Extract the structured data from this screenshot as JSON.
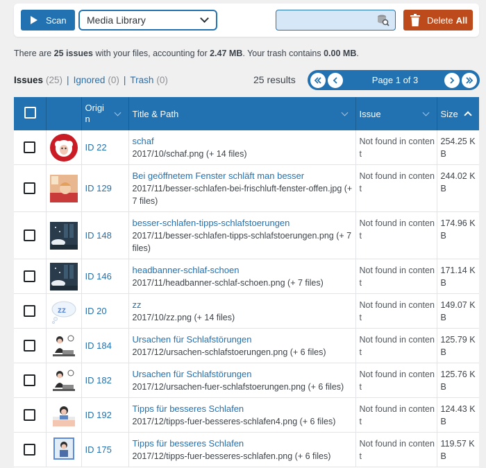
{
  "toolbar": {
    "scan_label": "Scan",
    "source_select": "Media Library",
    "search_placeholder": "",
    "delete_label": "Delete",
    "delete_bold": "All"
  },
  "summary": {
    "prefix": "There are ",
    "issue_count": "25 issues",
    "middle": " with your files, accounting for ",
    "size": "2.47 MB",
    "trash_text": ". Your trash contains ",
    "trash_size": "0.00 MB",
    "suffix": "."
  },
  "filters": {
    "issues": "Issues",
    "issues_count": "(25)",
    "ignored": "Ignored",
    "ignored_count": "(0)",
    "trash": "Trash",
    "trash_count": "(0)"
  },
  "results": "25 results",
  "pager": {
    "label": "Page 1 of 3"
  },
  "columns": {
    "origin": "Origi n",
    "title": "Title & Path",
    "issue": "Issue",
    "size": "Size"
  },
  "rows": [
    {
      "thumb": "sheep",
      "id": "ID 22",
      "title": "schaf",
      "path": "2017/10/schaf.png (+ 14 files)",
      "issue": "Not found in content",
      "size": "254.25 KB"
    },
    {
      "thumb": "sleeping-person",
      "id": "ID 129",
      "title": "Bei geöffnetem Fenster schläft man besser",
      "path": "2017/11/besser-schlafen-bei-frischluft-fenster-offen.jpg (+ 7 files)",
      "issue": "Not found in content",
      "size": "244.02 KB"
    },
    {
      "thumb": "night-window",
      "id": "ID 148",
      "title": "besser-schlafen-tipps-schlafstoerungen",
      "path": "2017/11/besser-schlafen-tipps-schlafstoerungen.png (+ 7 files)",
      "issue": "Not found in content",
      "size": "174.96 KB"
    },
    {
      "thumb": "night-window",
      "id": "ID 146",
      "title": "headbanner-schlaf-schoen",
      "path": "2017/11/headbanner-schlaf-schoen.png (+ 7 files)",
      "issue": "Not found in content",
      "size": "171.14 KB"
    },
    {
      "thumb": "zz-cloud",
      "id": "ID 20",
      "title": "zz",
      "path": "2017/10/zz.png (+ 14 files)",
      "issue": "Not found in content",
      "size": "149.07 KB"
    },
    {
      "thumb": "person-desk",
      "id": "ID 184",
      "title": "Ursachen für Schlafstörungen",
      "path": "2017/12/ursachen-schlafstoerungen.png (+ 6 files)",
      "issue": "Not found in content",
      "size": "125.79 KB"
    },
    {
      "thumb": "person-desk",
      "id": "ID 182",
      "title": "Ursachen für Schlafstörungen",
      "path": "2017/12/ursachen-fuer-schlafstoerungen.png (+ 6 files)",
      "issue": "Not found in content",
      "size": "125.76 KB"
    },
    {
      "thumb": "person-bed",
      "id": "ID 192",
      "title": "Tipps für besseres Schlafen",
      "path": "2017/12/tipps-fuer-besseres-schlafen4.png (+ 6 files)",
      "issue": "Not found in content",
      "size": "124.43 KB"
    },
    {
      "thumb": "person-frame",
      "id": "ID 175",
      "title": "Tipps für besseres Schlafen",
      "path": "2017/12/tipps-fuer-besseres-schlafen.png (+ 6 files)",
      "issue": "Not found in content",
      "size": "119.57 KB"
    }
  ]
}
